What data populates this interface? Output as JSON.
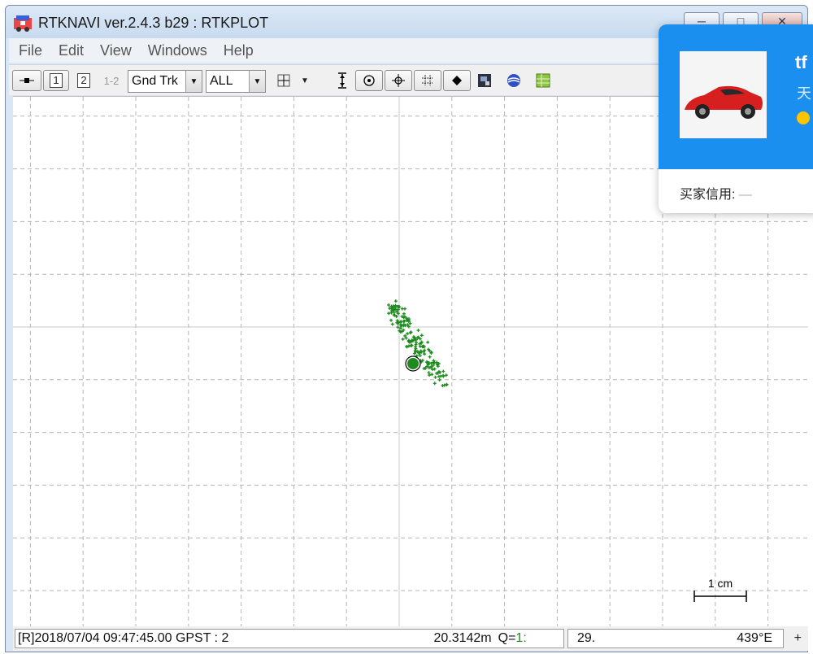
{
  "window": {
    "title": "RTKNAVI ver.2.4.3 b29 : RTKPLOT",
    "minimize_icon": "minimize-icon",
    "maximize_icon": "maximize-icon",
    "close_icon": "close-icon"
  },
  "menu": [
    "File",
    "Edit",
    "View",
    "Windows",
    "Help"
  ],
  "toolbar": {
    "btn_1": "1",
    "btn_2": "2",
    "btn_12": "1-2",
    "plot_type": "Gnd Trk",
    "sat_filter": "ALL",
    "icons": [
      "solution-icon",
      "crosshair-icon",
      "dropdown-icon",
      "fit-vertical-icon",
      "center-origin-icon",
      "crosshair-center-icon",
      "grid-icon",
      "point-icon",
      "satellite-image-icon",
      "globe-icon",
      "map-icon"
    ]
  },
  "plot": {
    "scale_label": "1 cm",
    "colors": {
      "points": "#1f8a1f",
      "grid": "#b5b5b5",
      "center_line": "#c8c8c8"
    }
  },
  "status": {
    "left": "[R]2018/07/04 09:47:45.00 GPST : 2",
    "height": "20.3142m",
    "quality_label": "Q=",
    "quality_value": "1:",
    "right": "29.",
    "right_end": "439°E",
    "plus": "+"
  },
  "popup": {
    "name": "tf",
    "sub": "天",
    "credit_label": "买家信用:",
    "credit_value": "—"
  }
}
